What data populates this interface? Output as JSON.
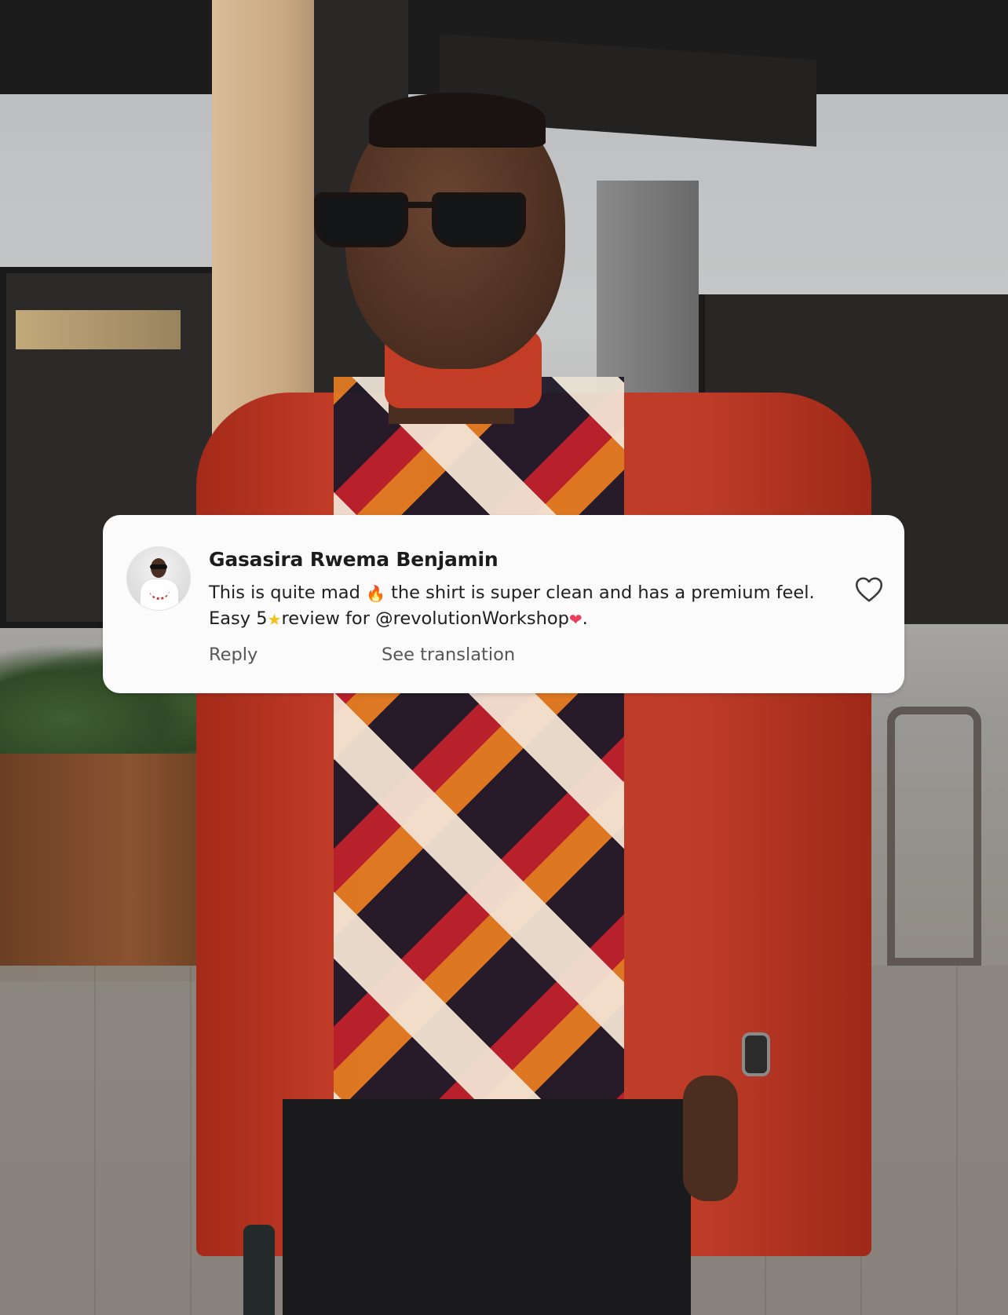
{
  "comment": {
    "author": "Gasasira Rwema Benjamin",
    "text_part1": "This is quite mad ",
    "emoji_fire": "🔥",
    "text_part2": " the shirt is super clean and has a premium feel.",
    "text_part3": "Easy 5",
    "emoji_star": "★",
    "text_part4": "review for @revolutionWorkshop",
    "emoji_heart": "❤",
    "text_part5": ".",
    "reply_label": "Reply",
    "translate_label": "See translation",
    "like_icon": "heart-outline-icon"
  },
  "colors": {
    "card_background": "#fbfbfb",
    "author_text": "#1c1c1c",
    "action_text": "#565656"
  }
}
